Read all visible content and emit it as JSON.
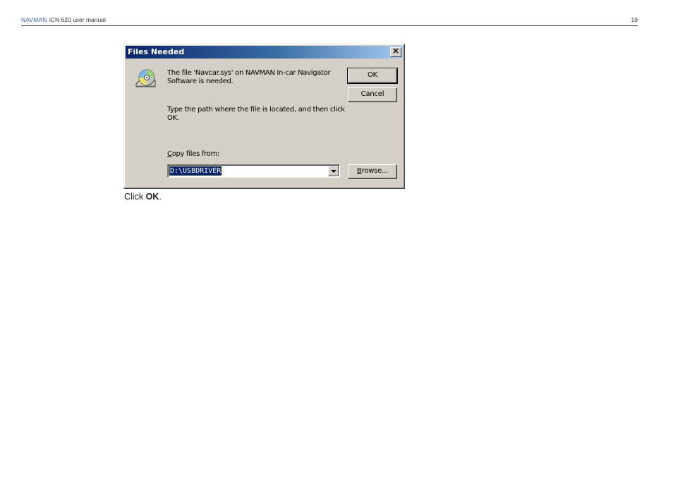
{
  "header": {
    "brand": "NAVMAN",
    "manual_title": "iCN 620 user manual",
    "page_number": "19"
  },
  "dialog": {
    "title": "Files Needed",
    "close_glyph": "✕",
    "icon": "cd-disc-icon",
    "message_line1a": "The file 'Navcar.sys' on NAVMAN In-car Navigator",
    "message_line1b": "Software is needed.",
    "message_line2a": "Type the path where the file is located, and then click",
    "message_line2b": "OK.",
    "copy_label_accel": "C",
    "copy_label_rest": "opy files from:",
    "path_value": "D:\\USBDRIVER",
    "ok_label": "OK",
    "cancel_label": "Cancel",
    "browse_accel": "B",
    "browse_rest": "rowse..."
  },
  "caption": {
    "prefix": "Click ",
    "bold": "OK",
    "suffix": "."
  },
  "colors": {
    "titlebar_start": "#0a246a",
    "titlebar_end": "#a6caf0",
    "dialog_face": "#d4d0c8",
    "brand": "#3a5fa8"
  }
}
